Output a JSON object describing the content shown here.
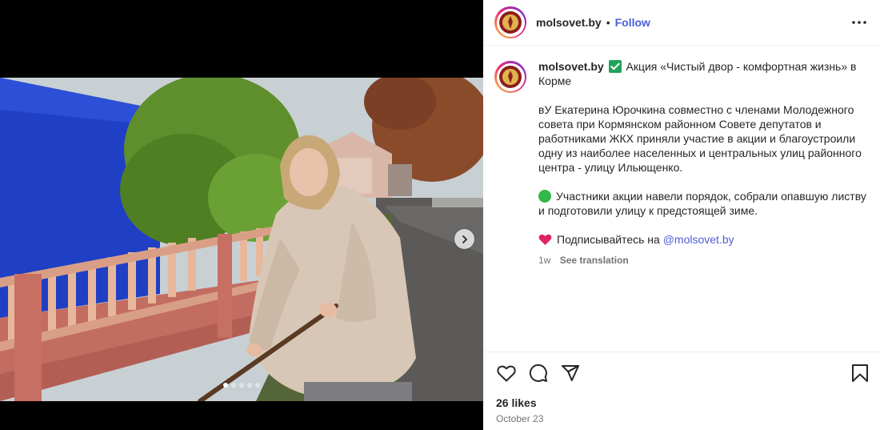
{
  "post": {
    "username": "molsovet.by",
    "separator": "•",
    "follow_label": "Follow",
    "more_icon": "more-horizontal-icon"
  },
  "caption": {
    "username": "molsovet.by",
    "title": "Акция «Чистый двор - комфортная жизнь» в Корме",
    "paragraph1": "вУ Екатерина Юрочкина совместно с членами Молодежного совета при Кормянском районном Совете депутатов и работниками ЖКХ приняли участие в акции и благоустроили одну из наиболее населенных и центральных улиц районного центра - улицу Ильющенко.",
    "paragraph2": "Участники акции навели порядок, собрали опавшую листву и подготовили улицу к предстоящей зиме.",
    "subscribe_text": "Подписывайтесь на ",
    "mention": "@molsovet.by",
    "age": "1w",
    "see_translation": "See translation"
  },
  "carousel": {
    "slide_count": 5,
    "active_slide": 1
  },
  "footer": {
    "likes": "26 likes",
    "date": "October 23"
  },
  "colors": {
    "link": "#4c5fd7",
    "text": "#262626",
    "muted": "#737373",
    "check": "#22a35a",
    "green_circle": "#33b84a",
    "heart": "#e0245e"
  }
}
